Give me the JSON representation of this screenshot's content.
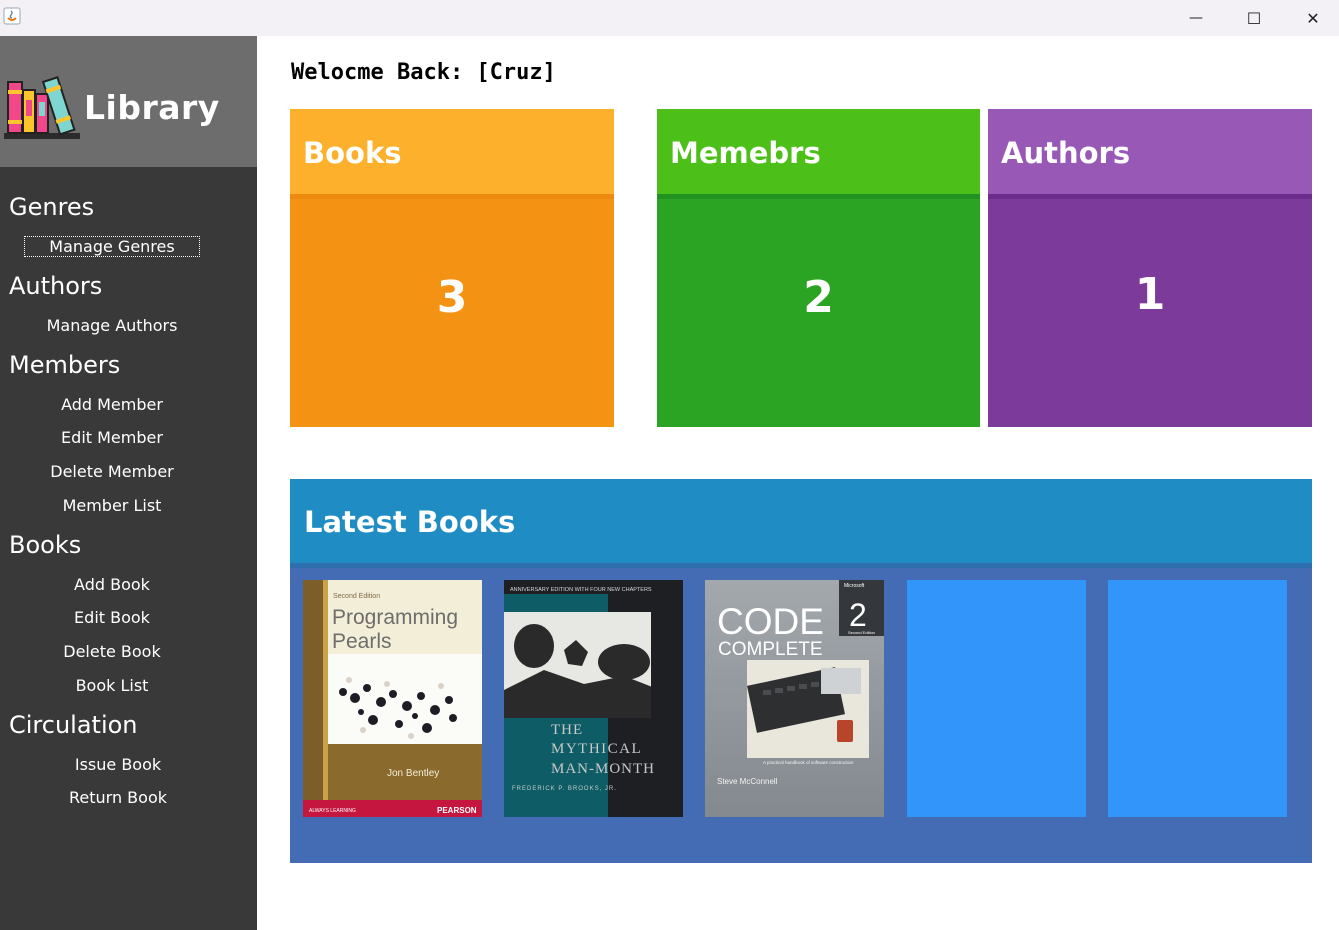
{
  "window": {
    "minimize_glyph": "—",
    "maximize_glyph": "☐",
    "close_glyph": "✕"
  },
  "sidebar": {
    "logo_text": "Library",
    "sections": [
      {
        "header": "Genres",
        "items": [
          "Manage Genres"
        ]
      },
      {
        "header": "Authors",
        "items": [
          "Manage Authors"
        ]
      },
      {
        "header": "Members",
        "items": [
          "Add Member",
          "Edit Member",
          "Delete Member",
          "Member List"
        ]
      },
      {
        "header": "Books",
        "items": [
          "Add Book",
          "Edit Book",
          "Delete Book",
          "Book List"
        ]
      },
      {
        "header": "Circulation",
        "items": [
          "Issue Book",
          "Return Book"
        ]
      }
    ]
  },
  "main": {
    "welcome": "Welocme Back: [Cruz]",
    "cards": [
      {
        "title": "Books",
        "count": "3",
        "head_color": "#fdb02b",
        "divider_color": "#ef8a10",
        "body_color": "#f49313"
      },
      {
        "title": "Memebrs",
        "count": "2",
        "head_color": "#4cc019",
        "divider_color": "#219221",
        "body_color": "#2ba423"
      },
      {
        "title": "Authors",
        "count": "1",
        "head_color": "#9859b6",
        "divider_color": "#6b2c8c",
        "body_color": "#7c3b9b"
      }
    ],
    "latest": {
      "title": "Latest Books",
      "books": [
        {
          "edition": "Second Edition",
          "title_line1": "Programming",
          "title_line2": "Pearls",
          "author": "Jon Bentley",
          "footer_left": "ALWAYS LEARNING",
          "footer_right": "PEARSON"
        },
        {
          "banner": "ANNIVERSARY EDITION WITH FOUR NEW CHAPTERS",
          "title_line1": "THE",
          "title_line2": "MYTHICAL",
          "title_line3": "MAN-MONTH",
          "author": "FREDERICK P. BROOKS, JR."
        },
        {
          "brand": "Microsoft",
          "title_line1": "CODE",
          "title_line2": "COMPLETE",
          "number": "2",
          "number_sub": "Second Edition",
          "subtitle": "A practical handbook of software construction",
          "author": "Steve McConnell"
        },
        {
          "placeholder": true
        },
        {
          "placeholder": true
        }
      ]
    }
  }
}
